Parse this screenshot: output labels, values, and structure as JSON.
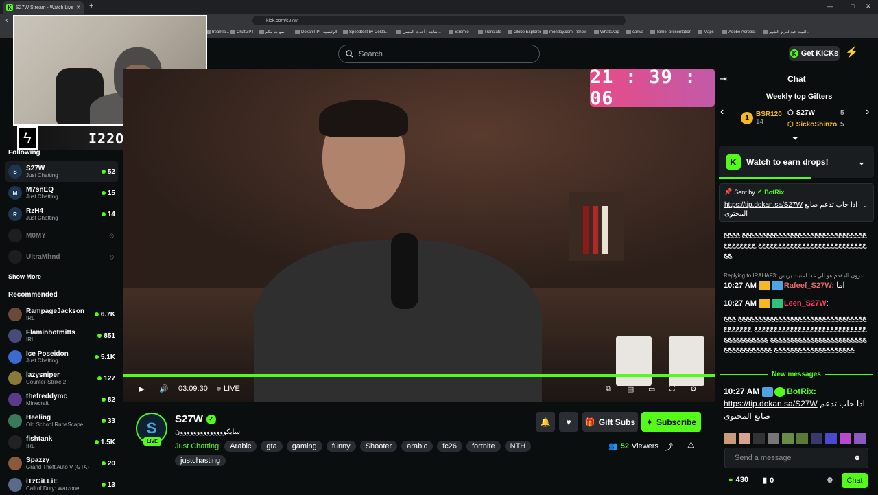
{
  "browser": {
    "tab_title": "S27W Stream - Watch Live on Ki",
    "url": "kick.com/s27w",
    "bookmarks": [
      "treamla...",
      "ChatGPT",
      "اصوات مكم",
      "DokanTIP - الرئيسية",
      "Speedtest by Ookla...",
      "شاهد | أحدث المسل...",
      "Stremio",
      "Translate",
      "Globe Explorer",
      "monday.com - Show",
      "WhatsApp",
      "canva",
      "Tome, presentation",
      "Maps",
      "Adobe Acrobat",
      "البيت عبدالعزيز الشهر..."
    ]
  },
  "header": {
    "search_placeholder": "Search",
    "get_kicks": "Get KICKs"
  },
  "webcam": {
    "banner_text": "I22OV"
  },
  "sidebar": {
    "following_title": "Following",
    "following": [
      {
        "name": "S27W",
        "category": "Just Chatting",
        "viewers": "52",
        "avatar": "S"
      },
      {
        "name": "M7snEQ",
        "category": "Just Chatting",
        "viewers": "15",
        "avatar": "M"
      },
      {
        "name": "RzH4",
        "category": "Just Chatting",
        "viewers": "14",
        "avatar": "R"
      }
    ],
    "offline": [
      {
        "name": "M0MY"
      },
      {
        "name": "UltraMhnd"
      }
    ],
    "show_more": "Show More",
    "recommended_title": "Recommended",
    "recommended": [
      {
        "name": "RampageJackson",
        "category": "IRL",
        "viewers": "6.7K"
      },
      {
        "name": "Flaminhotmitts",
        "category": "IRL",
        "viewers": "851"
      },
      {
        "name": "Ice Poseidon",
        "category": "Just Chatting",
        "viewers": "5.1K"
      },
      {
        "name": "lazysniper",
        "category": "Counter-Strike 2",
        "viewers": "127"
      },
      {
        "name": "thefreddymc",
        "category": "Minecraft",
        "viewers": "82"
      },
      {
        "name": "Heeling",
        "category": "Old School RuneScape",
        "viewers": "33"
      },
      {
        "name": "fishtank",
        "category": "IRL",
        "viewers": "1.5K"
      },
      {
        "name": "Spazzy",
        "category": "Grand Theft Auto V (GTA)",
        "viewers": "20"
      },
      {
        "name": "iTzGiLLiE",
        "category": "Call of Duty: Warzone",
        "viewers": "13"
      }
    ]
  },
  "player": {
    "clock": "21 : 39 : 06",
    "time": "03:09:30",
    "live": "LIVE",
    "progress": 1.0
  },
  "stream": {
    "name": "S27W",
    "title": "سايكوووووووووووووون",
    "category": "Just Chatting",
    "tags": [
      "Arabic",
      "gta",
      "gaming",
      "funny",
      "Shooter",
      "arabic",
      "fc26",
      "fortnite",
      "NTH",
      "justchasting"
    ],
    "gift_subs": "Gift Subs",
    "subscribe": "Subscribe",
    "viewers": "52",
    "viewers_label": "Viewers",
    "live_badge": "LIVE"
  },
  "chat": {
    "title": "Chat",
    "gifters_title": "Weekly top Gifters",
    "gifters": [
      {
        "rank": "1",
        "name": "BSR120",
        "count": "14",
        "color": "#f5b922"
      },
      {
        "name": "S27W",
        "count": "5",
        "color": "#ffffff"
      },
      {
        "name": "SickoShinzo",
        "count": "5",
        "color": "#f5b922"
      }
    ],
    "drops": "Watch to earn drops!",
    "pinned": {
      "sent_by": "Sent by",
      "user": "BotRix",
      "link": "https://tip.dokan.sa/S27W",
      "text1": "اذا حاب تدعم",
      "text2": "صانع المحتوى"
    },
    "spam1": "ﻊﻊﻊﻊﻊﻊﻊﻊﻊﻊﻊﻊﻊﻊﻊﻊﻊﻊﻊﻊﻊﻊﻊﻊﻊﻊﻊﻊﻊﻊﻊ ﻊﻊﻊﻊﻊﻊﻊﻊﻊﻊﻊﻊﻊﻊﻊﻊﻊﻊﻊﻊﻊﻊﻊﻊﻊﻊﻊﻊﻊﻊﻊ ﻊﻊﻊﻊﻊﻊﻊﻊﻊﻊ",
    "reply": "Replying to IRAHAF3: تدرون المقدم هو الي غدا اعتبت بريس",
    "m1": {
      "time": "10:27 AM",
      "user": "Rafeef_S27W:",
      "user_color": "#e06a6a",
      "text": "اما"
    },
    "m2": {
      "time": "10:27 AM",
      "user": "Leen_S27W",
      "user_color": "#ff3a5c",
      "text": "ﻊﻊﻊﻊﻊﻊﻊﻊﻊﻊﻊﻊﻊﻊﻊﻊﻊﻊﻊﻊﻊﻊﻊﻊﻊﻊﻊﻊﻊﻊﻊﻊ ﻊﻊﻊﻊﻊﻊﻊﻊﻊﻊﻊﻊﻊﻊﻊﻊﻊﻊﻊﻊﻊﻊﻊﻊﻊﻊﻊﻊﻊﻊﻊ ﻊﻊﻊﻊﻊﻊﻊﻊﻊﻊﻊﻊﻊﻊﻊﻊﻊﻊﻊﻊﻊﻊﻊﻊﻊﻊﻊﻊﻊﻊﻊ ﻊﻊﻊﻊﻊﻊﻊﻊﻊﻊﻊﻊﻊﻊﻊﻊﻊﻊﻊﻊﻊﻊﻊﻊﻊﻊﻊﻊﻊﻊﻊ ﻊﻊﻊﻊﻊﻊﻊﻊﻊﻊﻊﻊ"
    },
    "new_messages": "New messages",
    "m3": {
      "time": "10:27 AM",
      "user": "BotRix:",
      "user_color": "#53fc18",
      "link": "https://tip.dokan.sa/S27W",
      "text": "اذا حاب تدعم صانع المحتوى"
    },
    "input_placeholder": "Send a message",
    "points": "430",
    "kicks": "0",
    "send": "Chat"
  }
}
